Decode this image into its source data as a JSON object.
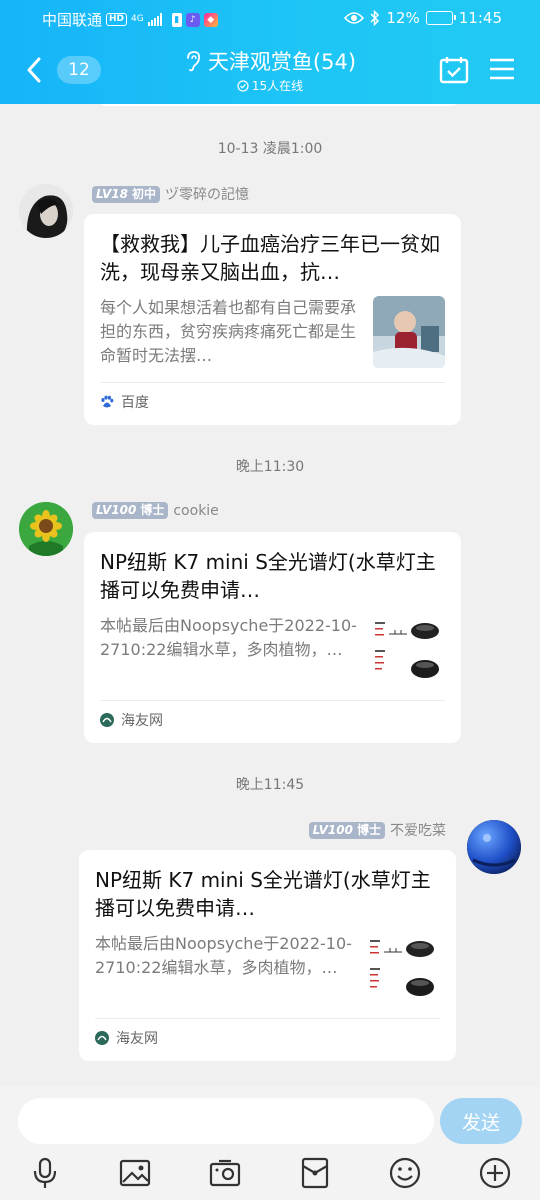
{
  "status_bar": {
    "carrier": "中国联通",
    "hd": "HD",
    "network": "4G",
    "battery_percent": "12%",
    "battery_level": 0.12,
    "time": "11:45"
  },
  "header": {
    "unread_count": "12",
    "title": "天津观赏鱼(54)",
    "online": "15人在线"
  },
  "messages": [
    {
      "time": "10-13 凌晨1:00",
      "sender": "ヅ零碎の記憶",
      "level": "LV18",
      "rank": "初中",
      "card": {
        "title": "【救救我】儿子血癌治疗三年已一贫如洗，现母亲又脑出血，抗…",
        "desc": "每个人如果想活着也都有自己需要承担的东西，贫穷疾病疼痛死亡都是生命暂时无法摆…",
        "source": "百度"
      }
    },
    {
      "time": "晚上11:30",
      "sender": "cookie",
      "level": "LV100",
      "rank": "博士",
      "card": {
        "title": "NP纽斯 K7 mini S全光谱灯(水草灯主播可以免费申请…",
        "desc": "本帖最后由Noopsyche于2022-10-2710:22编辑水草，多肉植物，…",
        "source": "海友网"
      }
    },
    {
      "time": "晚上11:45",
      "sender": "不爱吃菜",
      "level": "LV100",
      "rank": "博士",
      "card": {
        "title": "NP纽斯 K7 mini S全光谱灯(水草灯主播可以免费申请…",
        "desc": "本帖最后由Noopsyche于2022-10-2710:22编辑水草，多肉植物，…",
        "source": "海友网"
      }
    }
  ],
  "input": {
    "placeholder": "",
    "send_label": "发送"
  },
  "colors": {
    "header": "#16b4f9",
    "send_button": "#a3d4f3",
    "level_badge": "#a9b5c8"
  },
  "icons": {
    "toolbar": [
      "microphone-icon",
      "image-icon",
      "camera-icon",
      "red-packet-icon",
      "emoji-icon",
      "plus-icon"
    ]
  }
}
